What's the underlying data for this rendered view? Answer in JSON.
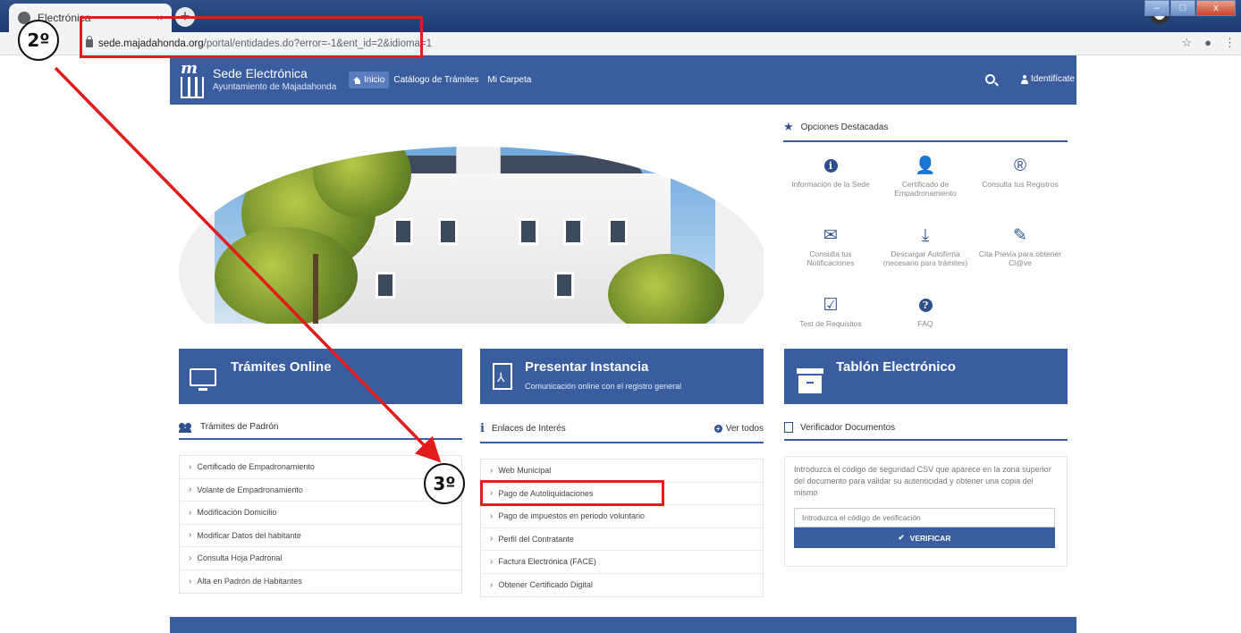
{
  "browser": {
    "tab_title": "Electrónica",
    "tab_close": "×",
    "new_tab": "+",
    "url_host": "sede.majadahonda.org",
    "url_path": "/portal/entidades.do?error=-1&ent_id=2&idioma=1",
    "bookmark_star": "☆",
    "menu_dots": "⋮",
    "window_buttons": {
      "minimize": "–",
      "maximize": "□",
      "close": "x"
    }
  },
  "header": {
    "logo_letter": "m",
    "title": "Sede Electrónica",
    "subtitle": "Ayuntamiento de Majadahonda",
    "nav": [
      {
        "label": "Inicio"
      },
      {
        "label": "Catálogo de Trámites"
      },
      {
        "label": "Mi Carpeta"
      }
    ],
    "identify_label": "Identifícate"
  },
  "opciones": {
    "title": "Opciones Destacadas",
    "items": [
      {
        "icon": "info-icon",
        "label": "Información de la Sede"
      },
      {
        "icon": "person-icon",
        "label": "Certificado de Empadronamiento"
      },
      {
        "icon": "registered-icon",
        "label": "Consulta tus Registros"
      },
      {
        "icon": "envelope-open-icon",
        "label": "Consulta tus Notificaciones"
      },
      {
        "icon": "download-icon",
        "label": "Descargar Autofirma (necesario para trámites)"
      },
      {
        "icon": "edit-icon",
        "label": "Cita Previa para obtener Cl@ve"
      },
      {
        "icon": "checkbox-icon",
        "label": "Test de Requisitos"
      },
      {
        "icon": "question-icon",
        "label": "FAQ"
      }
    ]
  },
  "big_buttons": [
    {
      "title": "Trámites Online",
      "subtitle": ""
    },
    {
      "title": "Presentar Instancia",
      "subtitle": "Comunicación online con el registro general"
    },
    {
      "title": "Tablón Electrónico",
      "subtitle": ""
    }
  ],
  "padron": {
    "title": "Trámites de Padrón",
    "items": [
      "Certificado de Empadronamiento",
      "Volante de Empadronamiento",
      "Modificación Domicilio",
      "Modificar Datos del habitante",
      "Consulta Hoja Padronal",
      "Alta en Padrón de Habitantes"
    ]
  },
  "enlaces": {
    "title": "Enlaces de Interés",
    "ver_todos": "Ver todos",
    "items": [
      "Web Municipal",
      "Pago de Autoliquidaciones",
      "Pago de impuestos en periodo voluntario",
      "Perfil del Contratante",
      "Factura Electrónica (FACE)",
      "Obtener Certificado Digital"
    ]
  },
  "verificador": {
    "title": "Verificador Documentos",
    "text": "Introduzca el código de seguridad CSV que aparece en la zona superior del documento para validar su autenticidad y obtener una copia del mismo",
    "input_placeholder": "Introduzca el código de verificación",
    "button_label": "VERIFICAR"
  },
  "annotations": {
    "step2": "2º",
    "step3": "3º",
    "color": "#e21b1b"
  }
}
